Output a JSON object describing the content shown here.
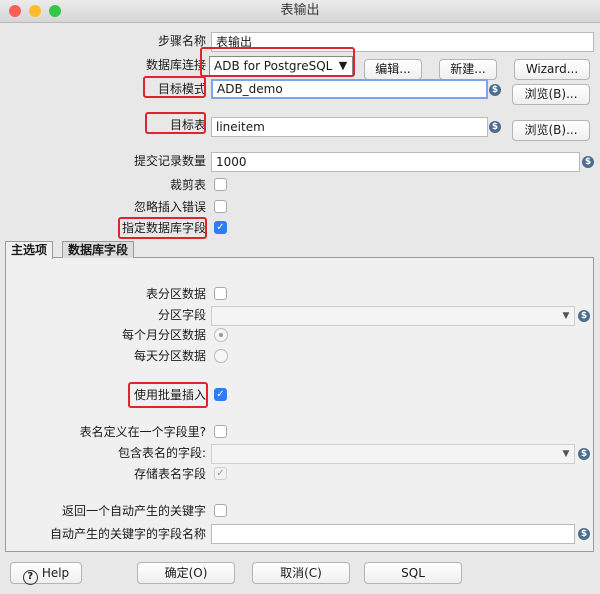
{
  "window": {
    "title": "表输出"
  },
  "form": {
    "step_name_label": "步骤名称",
    "step_name_value": "表输出",
    "connection_label": "数据库连接",
    "connection_value": "ADB for PostgreSQL",
    "edit_button": "编辑...",
    "new_button": "新建...",
    "wizard_button": "Wizard...",
    "schema_label": "目标模式",
    "schema_value": "ADB_demo",
    "browse_button": "浏览(B)...",
    "table_label": "目标表",
    "table_value": "lineitem",
    "commit_label": "提交记录数量",
    "commit_value": "1000",
    "truncate_label": "裁剪表",
    "ignore_label": "忽略插入错误",
    "specify_fields_label": "指定数据库字段",
    "truncate_checked": false,
    "ignore_checked": false,
    "specify_fields_checked": true
  },
  "tabs": [
    {
      "label": "主选项"
    },
    {
      "label": "数据库字段"
    }
  ],
  "main_options": {
    "partition_label": "表分区数据",
    "partition_field_label": "分区字段",
    "monthly_label": "每个月分区数据",
    "daily_label": "每天分区数据",
    "batch_label": "使用批量插入",
    "batch_checked": true,
    "name_in_field_label": "表名定义在一个字段里?",
    "name_field_label": "包含表名的字段:",
    "store_name_label": "存储表名字段",
    "return_key_label": "返回一个自动产生的关键字",
    "key_field_label": "自动产生的关键字的字段名称"
  },
  "footer": {
    "help": "Help",
    "ok": "确定(O)",
    "cancel": "取消(C)",
    "sql": "SQL"
  },
  "colors": {
    "close": "#fc5f57",
    "minimize": "#fdbc2e",
    "zoom": "#33c748",
    "accent": "#2f7cf6",
    "highlight": "#e0242c"
  }
}
